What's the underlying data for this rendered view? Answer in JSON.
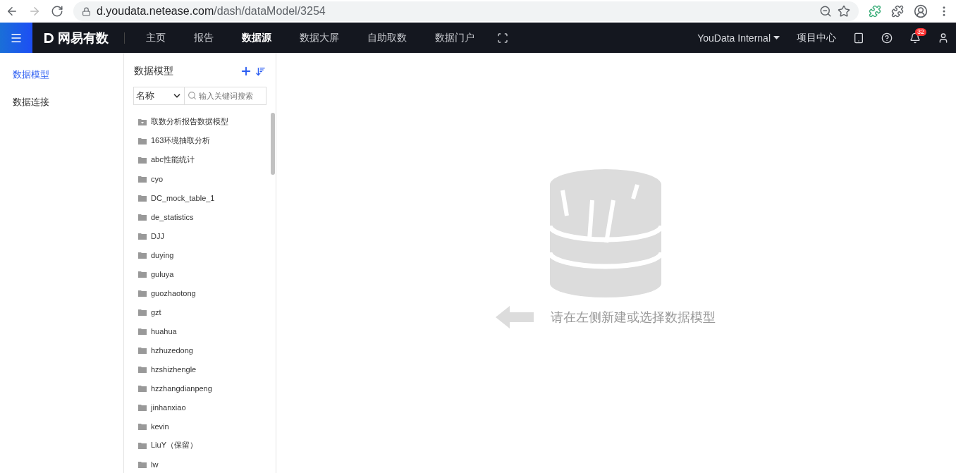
{
  "browser": {
    "url_host": "d.youdata.netease.com",
    "url_path": "/dash/dataModel/3254"
  },
  "nav": {
    "logo": "网易有数",
    "items": [
      {
        "label": "主页",
        "selected": false
      },
      {
        "label": "报告",
        "selected": false
      },
      {
        "label": "数据源",
        "selected": true
      },
      {
        "label": "数据大屏",
        "selected": false
      },
      {
        "label": "自助取数",
        "selected": false
      },
      {
        "label": "数据门户",
        "selected": false
      }
    ],
    "workspace": "YouData Internal",
    "project_center": "项目中心",
    "notifications": "32"
  },
  "side_menu": [
    {
      "label": "数据模型",
      "selected": true
    },
    {
      "label": "数据连接",
      "selected": false
    }
  ],
  "model_panel": {
    "title": "数据模型",
    "filter": "名称",
    "search_placeholder": "输入关键词搜索",
    "items": [
      {
        "name": "取数分析报告数据模型",
        "kind": "special"
      },
      {
        "name": "163环境抽取分析",
        "kind": "folder"
      },
      {
        "name": "abc性能统计",
        "kind": "folder"
      },
      {
        "name": "cyo",
        "kind": "folder"
      },
      {
        "name": "DC_mock_table_1",
        "kind": "folder"
      },
      {
        "name": "de_statistics",
        "kind": "folder"
      },
      {
        "name": "DJJ",
        "kind": "folder"
      },
      {
        "name": "duying",
        "kind": "folder"
      },
      {
        "name": "guluya",
        "kind": "folder"
      },
      {
        "name": "guozhaotong",
        "kind": "folder"
      },
      {
        "name": "gzt",
        "kind": "folder"
      },
      {
        "name": "huahua",
        "kind": "folder"
      },
      {
        "name": "hzhuzedong",
        "kind": "folder"
      },
      {
        "name": "hzshizhengle",
        "kind": "folder"
      },
      {
        "name": "hzzhangdianpeng",
        "kind": "folder"
      },
      {
        "name": "jinhanxiao",
        "kind": "folder"
      },
      {
        "name": "kevin",
        "kind": "folder"
      },
      {
        "name": "LiuY（保留）",
        "kind": "folder"
      },
      {
        "name": "lw",
        "kind": "folder"
      }
    ]
  },
  "empty_state": {
    "message": "请在左侧新建或选择数据模型"
  }
}
